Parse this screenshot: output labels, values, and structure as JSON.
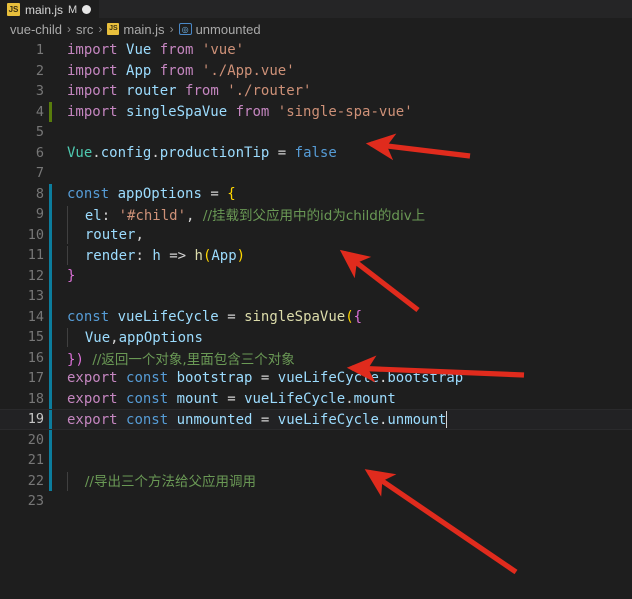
{
  "window": {
    "tab": {
      "icon": "js-file-icon",
      "filename": "main.js",
      "modified_badge": "M",
      "dirty_indicator": "●"
    },
    "breadcrumb": {
      "separator": "›",
      "items": [
        {
          "label": "vue-child",
          "icon": null
        },
        {
          "label": "src",
          "icon": null
        },
        {
          "label": "main.js",
          "icon": "js-file-icon"
        },
        {
          "label": "unmounted",
          "icon": "symbol-variable-icon"
        }
      ]
    }
  },
  "editor": {
    "language": "javascript",
    "active_line": 19,
    "theme_colors": {
      "background": "#1e1e1e",
      "foreground": "#d4d4d4",
      "keyword": "#c586c0",
      "control": "#569cd6",
      "variable": "#9cdcfe",
      "string": "#ce9178",
      "comment": "#6a9955",
      "function": "#dcdcaa",
      "class": "#4ec9b0",
      "bracket1": "#ffd700",
      "bracket2": "#da70d6",
      "gutter_added": "#587c0c",
      "gutter_modified": "#0c7d9d",
      "annotation_arrow": "#e02b1d"
    },
    "lines": [
      {
        "n": 1,
        "gutter": "none",
        "text": "import Vue from 'vue'"
      },
      {
        "n": 2,
        "gutter": "none",
        "text": "import App from './App.vue'"
      },
      {
        "n": 3,
        "gutter": "none",
        "text": "import router from './router'"
      },
      {
        "n": 4,
        "gutter": "added",
        "text": "import singleSpaVue from 'single-spa-vue'"
      },
      {
        "n": 5,
        "gutter": "none",
        "text": ""
      },
      {
        "n": 6,
        "gutter": "none",
        "text": "Vue.config.productionTip = false"
      },
      {
        "n": 7,
        "gutter": "none",
        "text": ""
      },
      {
        "n": 8,
        "gutter": "modified",
        "text": "const appOptions = {"
      },
      {
        "n": 9,
        "gutter": "modified",
        "text": "  el: '#child', //挂载到父应用中的id为child的div上"
      },
      {
        "n": 10,
        "gutter": "modified",
        "text": "  router,"
      },
      {
        "n": 11,
        "gutter": "modified",
        "text": "  render: h => h(App)"
      },
      {
        "n": 12,
        "gutter": "modified",
        "text": "}"
      },
      {
        "n": 13,
        "gutter": "modified",
        "text": ""
      },
      {
        "n": 14,
        "gutter": "modified",
        "text": "const vueLifeCycle = singleSpaVue({"
      },
      {
        "n": 15,
        "gutter": "modified",
        "text": "  Vue,appOptions"
      },
      {
        "n": 16,
        "gutter": "modified",
        "text": "}) //返回一个对象,里面包含三个对象"
      },
      {
        "n": 17,
        "gutter": "modified",
        "text": "export const bootstrap = vueLifeCycle.bootstrap"
      },
      {
        "n": 18,
        "gutter": "modified",
        "text": "export const mount = vueLifeCycle.mount"
      },
      {
        "n": 19,
        "gutter": "modified",
        "text": "export const unmounted = vueLifeCycle.unmount"
      },
      {
        "n": 20,
        "gutter": "modified",
        "text": ""
      },
      {
        "n": 21,
        "gutter": "modified",
        "text": ""
      },
      {
        "n": 22,
        "gutter": "modified",
        "text": "  //导出三个方法给父应用调用"
      },
      {
        "n": 23,
        "gutter": "none",
        "text": ""
      }
    ]
  },
  "annotations": {
    "color": "#e02b1d",
    "arrows": [
      {
        "name": "arrow-to-import-singlespavue",
        "points_to_line": 4
      },
      {
        "name": "arrow-to-el-child-comment",
        "points_to_line": 9
      },
      {
        "name": "arrow-to-vue-appoptions",
        "points_to_line": 15
      },
      {
        "name": "arrow-to-unmounted-export",
        "points_to_line": 19
      }
    ]
  }
}
